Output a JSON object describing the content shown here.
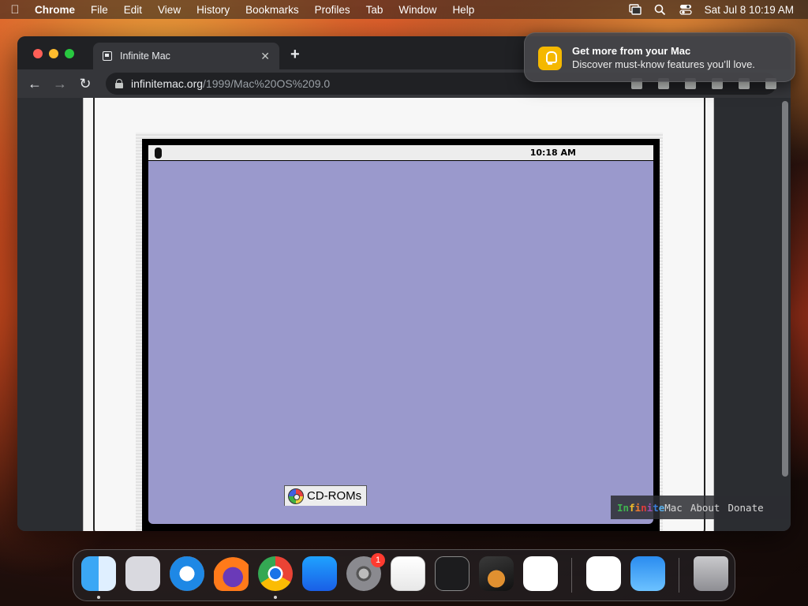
{
  "menubar": {
    "app_name": "Chrome",
    "items": [
      "File",
      "Edit",
      "View",
      "History",
      "Bookmarks",
      "Profiles",
      "Tab",
      "Window",
      "Help"
    ],
    "clock": "Sat Jul 8  10:19 AM"
  },
  "browser": {
    "tab_title": "Infinite Mac",
    "url_host": "infinitemac.org",
    "url_path": "/1999/Mac%20OS%209.0"
  },
  "emulator": {
    "clock": "10:18 AM",
    "cdrom_label": "CD-ROMs",
    "desktop_color": "#9a99cc"
  },
  "site_links": {
    "brand_letters": [
      "I",
      "n",
      "f",
      "i",
      "n",
      "i",
      "t",
      "e"
    ],
    "brand_colors": [
      "#3fb34f",
      "#3fb34f",
      "#f1bb2a",
      "#ec7a30",
      "#e03c3c",
      "#9b4fb0",
      "#3b7fdc",
      "#5aaee8"
    ],
    "brand_suffix": "Mac",
    "about": "About",
    "donate": "Donate"
  },
  "notification": {
    "title": "Get more from your Mac",
    "body": "Discover must-know features you’ll love."
  },
  "dock": {
    "settings_badge": "1"
  }
}
